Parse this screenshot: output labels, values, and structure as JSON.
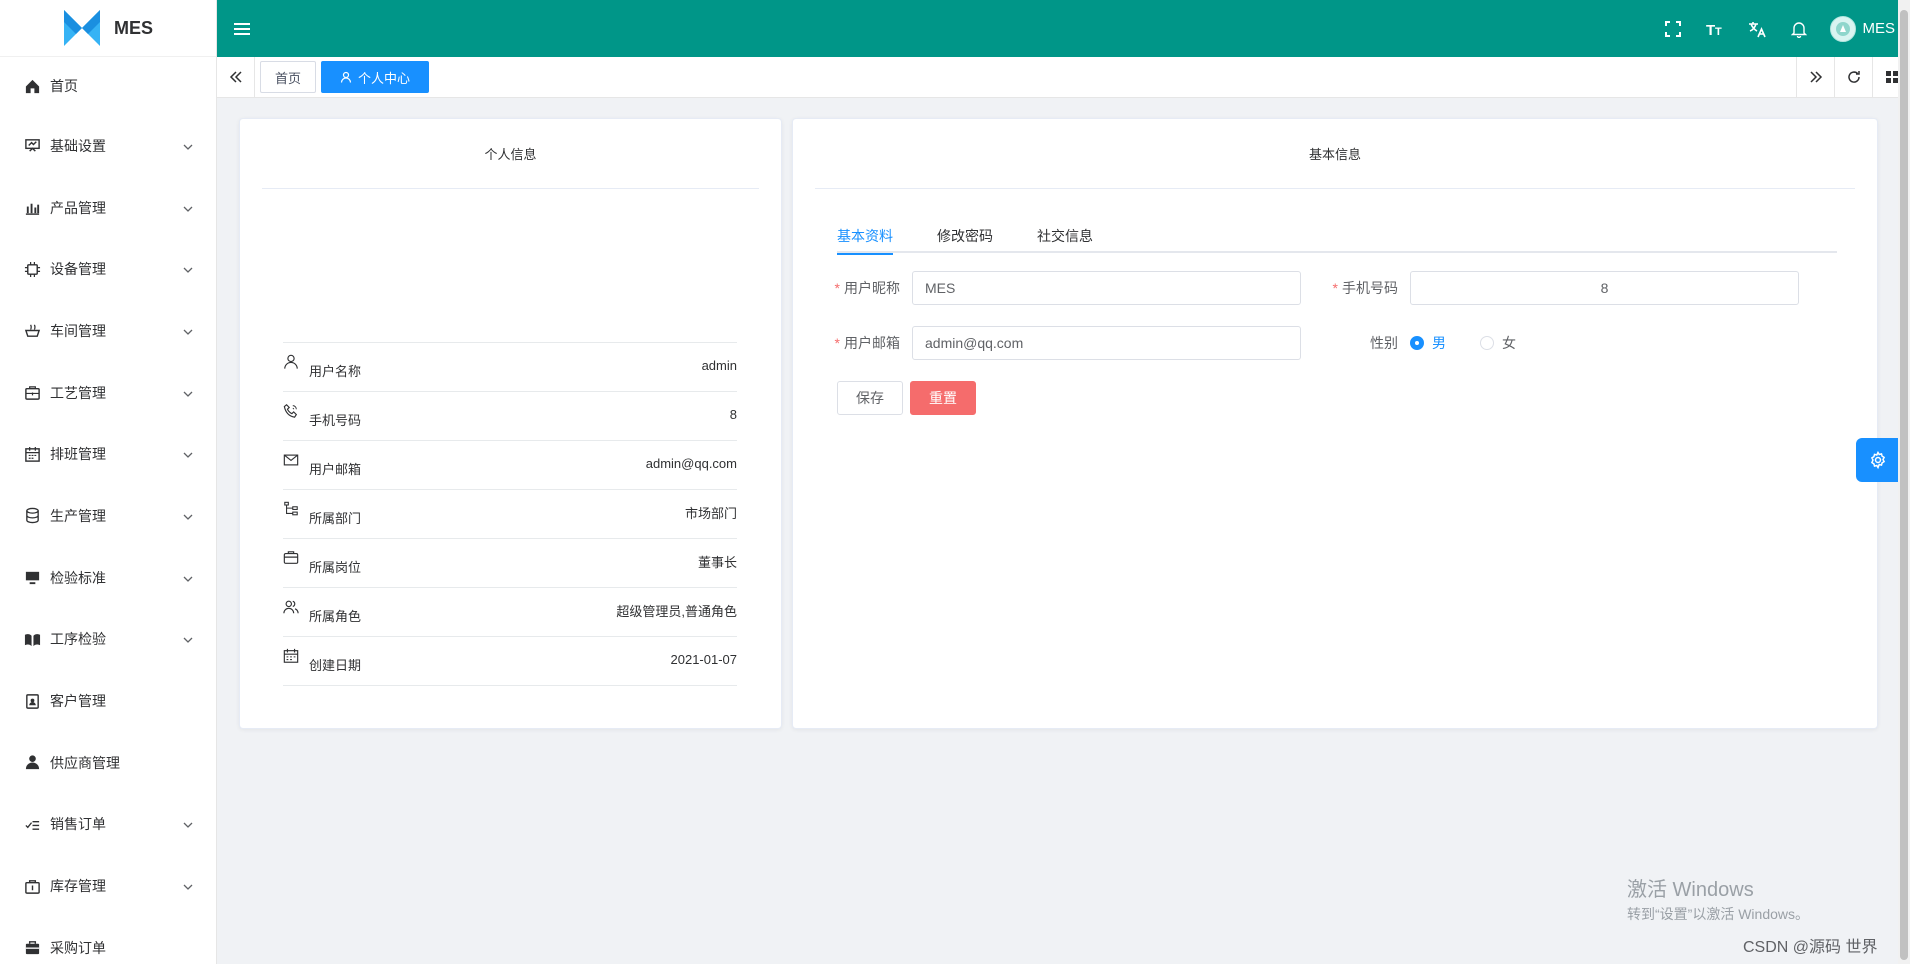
{
  "app": {
    "name": "MES"
  },
  "sidebar": {
    "items": [
      {
        "label": "首页",
        "icon": "home-icon",
        "expandable": false
      },
      {
        "label": "基础设置",
        "icon": "presentation-icon",
        "expandable": true
      },
      {
        "label": "产品管理",
        "icon": "bar-chart-icon",
        "expandable": true
      },
      {
        "label": "设备管理",
        "icon": "chip-icon",
        "expandable": true
      },
      {
        "label": "车间管理",
        "icon": "pot-icon",
        "expandable": true
      },
      {
        "label": "工艺管理",
        "icon": "briefcase-icon",
        "expandable": true
      },
      {
        "label": "排班管理",
        "icon": "calendar-icon",
        "expandable": true
      },
      {
        "label": "生产管理",
        "icon": "database-icon",
        "expandable": true
      },
      {
        "label": "检验标准",
        "icon": "monitor-icon",
        "expandable": true
      },
      {
        "label": "工序检验",
        "icon": "book-icon",
        "expandable": true
      },
      {
        "label": "客户管理",
        "icon": "contact-card-icon",
        "expandable": false
      },
      {
        "label": "供应商管理",
        "icon": "user-icon",
        "expandable": false
      },
      {
        "label": "销售订单",
        "icon": "check-list-icon",
        "expandable": true
      },
      {
        "label": "库存管理",
        "icon": "box-icon",
        "expandable": true
      },
      {
        "label": "采购订单",
        "icon": "suitcase-icon",
        "expandable": false
      }
    ]
  },
  "header": {
    "user_name": "MES"
  },
  "tags": {
    "home": "首页",
    "active": "个人中心"
  },
  "profile": {
    "title": "个人信息",
    "rows": [
      {
        "label": "用户名称",
        "value": "admin",
        "icon": "user-icon"
      },
      {
        "label": "手机号码",
        "value": "8",
        "icon": "phone-icon"
      },
      {
        "label": "用户邮箱",
        "value": "admin@qq.com",
        "icon": "mail-icon"
      },
      {
        "label": "所属部门",
        "value": "市场部门",
        "icon": "tree-icon"
      },
      {
        "label": "所属岗位",
        "value": "董事长",
        "icon": "post-icon"
      },
      {
        "label": "所属角色",
        "value": "超级管理员,普通角色",
        "icon": "peoples-icon"
      },
      {
        "label": "创建日期",
        "value": "2021-01-07",
        "icon": "date-icon"
      }
    ]
  },
  "basic": {
    "title": "基本信息",
    "tabs": [
      "基本资料",
      "修改密码",
      "社交信息"
    ],
    "nickname_label": "用户昵称",
    "nickname_value": "MES",
    "phone_label": "手机号码",
    "phone_value": "8",
    "email_label": "用户邮箱",
    "email_value": "admin@qq.com",
    "gender_label": "性别",
    "gender_options": [
      "男",
      "女"
    ],
    "gender_selected": "男",
    "save_label": "保存",
    "reset_label": "重置"
  },
  "watermark": {
    "title": "激活 Windows",
    "subtitle": "转到“设置”以激活 Windows。",
    "csdn": "CSDN @源码 世界"
  },
  "colors": {
    "header": "#009688",
    "primary": "#1890ff",
    "danger": "#f56c6c"
  }
}
